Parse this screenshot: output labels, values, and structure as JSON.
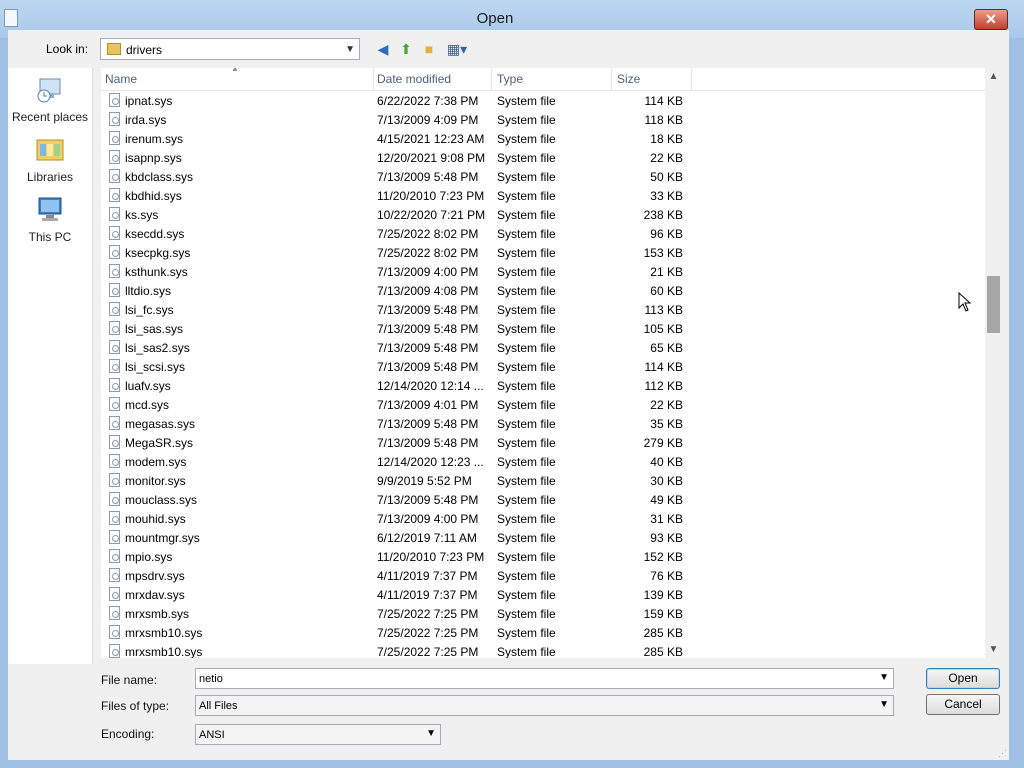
{
  "window": {
    "title": "Open",
    "close_label": "✕"
  },
  "toolbar": {
    "look_in_label": "Look in:",
    "look_in_value": "drivers",
    "back_icon": "back-arrow-icon",
    "up_icon": "up-folder-icon",
    "new_folder_icon": "new-folder-icon",
    "view_icon": "view-menu-icon"
  },
  "places": [
    {
      "label": "Recent places",
      "icon": "recent-places-icon"
    },
    {
      "label": "Libraries",
      "icon": "libraries-icon"
    },
    {
      "label": "This PC",
      "icon": "this-pc-icon"
    }
  ],
  "columns": {
    "name": "Name",
    "date": "Date modified",
    "type": "Type",
    "size": "Size"
  },
  "files": [
    {
      "name": "ipnat.sys",
      "date": "6/22/2022 7:38 PM",
      "type": "System file",
      "size": "114 KB"
    },
    {
      "name": "irda.sys",
      "date": "7/13/2009 4:09 PM",
      "type": "System file",
      "size": "118 KB"
    },
    {
      "name": "irenum.sys",
      "date": "4/15/2021 12:23 AM",
      "type": "System file",
      "size": "18 KB"
    },
    {
      "name": "isapnp.sys",
      "date": "12/20/2021 9:08 PM",
      "type": "System file",
      "size": "22 KB"
    },
    {
      "name": "kbdclass.sys",
      "date": "7/13/2009 5:48 PM",
      "type": "System file",
      "size": "50 KB"
    },
    {
      "name": "kbdhid.sys",
      "date": "11/20/2010 7:23 PM",
      "type": "System file",
      "size": "33 KB"
    },
    {
      "name": "ks.sys",
      "date": "10/22/2020 7:21 PM",
      "type": "System file",
      "size": "238 KB"
    },
    {
      "name": "ksecdd.sys",
      "date": "7/25/2022 8:02 PM",
      "type": "System file",
      "size": "96 KB"
    },
    {
      "name": "ksecpkg.sys",
      "date": "7/25/2022 8:02 PM",
      "type": "System file",
      "size": "153 KB"
    },
    {
      "name": "ksthunk.sys",
      "date": "7/13/2009 4:00 PM",
      "type": "System file",
      "size": "21 KB"
    },
    {
      "name": "lltdio.sys",
      "date": "7/13/2009 4:08 PM",
      "type": "System file",
      "size": "60 KB"
    },
    {
      "name": "lsi_fc.sys",
      "date": "7/13/2009 5:48 PM",
      "type": "System file",
      "size": "113 KB"
    },
    {
      "name": "lsi_sas.sys",
      "date": "7/13/2009 5:48 PM",
      "type": "System file",
      "size": "105 KB"
    },
    {
      "name": "lsi_sas2.sys",
      "date": "7/13/2009 5:48 PM",
      "type": "System file",
      "size": "65 KB"
    },
    {
      "name": "lsi_scsi.sys",
      "date": "7/13/2009 5:48 PM",
      "type": "System file",
      "size": "114 KB"
    },
    {
      "name": "luafv.sys",
      "date": "12/14/2020 12:14 ...",
      "type": "System file",
      "size": "112 KB"
    },
    {
      "name": "mcd.sys",
      "date": "7/13/2009 4:01 PM",
      "type": "System file",
      "size": "22 KB"
    },
    {
      "name": "megasas.sys",
      "date": "7/13/2009 5:48 PM",
      "type": "System file",
      "size": "35 KB"
    },
    {
      "name": "MegaSR.sys",
      "date": "7/13/2009 5:48 PM",
      "type": "System file",
      "size": "279 KB"
    },
    {
      "name": "modem.sys",
      "date": "12/14/2020 12:23 ...",
      "type": "System file",
      "size": "40 KB"
    },
    {
      "name": "monitor.sys",
      "date": "9/9/2019 5:52 PM",
      "type": "System file",
      "size": "30 KB"
    },
    {
      "name": "mouclass.sys",
      "date": "7/13/2009 5:48 PM",
      "type": "System file",
      "size": "49 KB"
    },
    {
      "name": "mouhid.sys",
      "date": "7/13/2009 4:00 PM",
      "type": "System file",
      "size": "31 KB"
    },
    {
      "name": "mountmgr.sys",
      "date": "6/12/2019 7:11 AM",
      "type": "System file",
      "size": "93 KB"
    },
    {
      "name": "mpio.sys",
      "date": "11/20/2010 7:23 PM",
      "type": "System file",
      "size": "152 KB"
    },
    {
      "name": "mpsdrv.sys",
      "date": "4/11/2019 7:37 PM",
      "type": "System file",
      "size": "76 KB"
    },
    {
      "name": "mrxdav.sys",
      "date": "4/11/2019 7:37 PM",
      "type": "System file",
      "size": "139 KB"
    },
    {
      "name": "mrxsmb.sys",
      "date": "7/25/2022 7:25 PM",
      "type": "System file",
      "size": "159 KB"
    },
    {
      "name": "mrxsmb10.sys",
      "date": "7/25/2022 7:25 PM",
      "type": "System file",
      "size": "285 KB"
    },
    {
      "name": "mrxsmb10.sys",
      "date": "7/25/2022 7:25 PM",
      "type": "System file",
      "size": "285 KB"
    }
  ],
  "form": {
    "file_name_label": "File name:",
    "file_name_value": "netio",
    "files_of_type_label": "Files of type:",
    "files_of_type_value": "All Files",
    "encoding_label": "Encoding:",
    "encoding_value": "ANSI",
    "open_label": "Open",
    "cancel_label": "Cancel"
  }
}
